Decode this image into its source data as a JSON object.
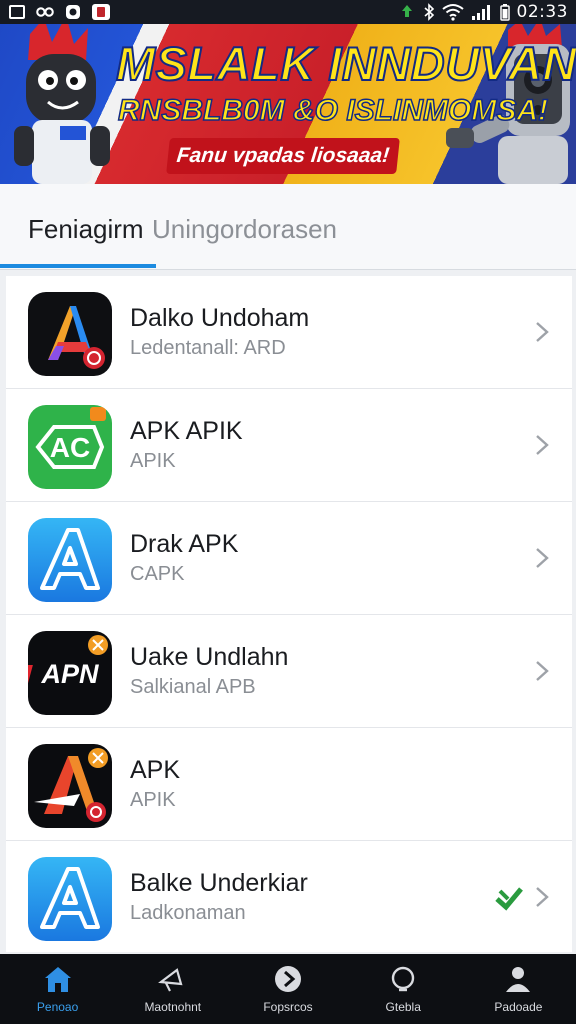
{
  "status_bar": {
    "time": "02:33",
    "left_icons": [
      "gallery-icon",
      "voicemail-icon",
      "app-icon",
      "notification-icon"
    ],
    "right_icons": [
      "recycle-icon",
      "bluetooth-icon",
      "wifi-icon",
      "signal-icon",
      "battery-icon"
    ]
  },
  "banner": {
    "title": "MSLALK INNDUVAN",
    "subtitle": "RNSBLB0M &O ISLINMOMSA!",
    "pill_text": "Fanu vpadas liosaaa!",
    "colors": {
      "title": "#ffe41a",
      "pill": "#c1121b"
    }
  },
  "tabs": [
    {
      "label": "Feniagirm",
      "active": true
    },
    {
      "label": "Uningordorasen",
      "active": false
    }
  ],
  "apps": [
    {
      "name": "Dalko Undoham",
      "subtitle": "Ledentanall: ARD",
      "icon": "prism-a-icon",
      "badge": null
    },
    {
      "name": "APK APIK",
      "subtitle": "APIK",
      "icon": "ac-green-icon",
      "badge": null
    },
    {
      "name": "Drak APK",
      "subtitle": "CAPK",
      "icon": "outline-a-icon",
      "badge": null
    },
    {
      "name": "Uake Undlahn",
      "subtitle": "Salkianal APB",
      "icon": "apn-icon",
      "badge": null
    },
    {
      "name": "APK",
      "subtitle": "APIK",
      "icon": "arrow-a-icon",
      "badge": null
    },
    {
      "name": "Balke Underkiar",
      "subtitle": "Ladkonaman",
      "icon": "outline-a-icon",
      "badge": "green-check-icon"
    }
  ],
  "bottom_nav": [
    {
      "label": "Penoao",
      "icon": "home-icon",
      "active": true
    },
    {
      "label": "Maotnohnt",
      "icon": "megaphone-icon",
      "active": false
    },
    {
      "label": "Fopsrcos",
      "icon": "play-icon",
      "active": false
    },
    {
      "label": "Gtebla",
      "icon": "search-icon",
      "active": false
    },
    {
      "label": "Padoade",
      "icon": "profile-icon",
      "active": false
    }
  ],
  "colors": {
    "accent": "#1d8be0",
    "nav_bg": "#0d0f13"
  }
}
